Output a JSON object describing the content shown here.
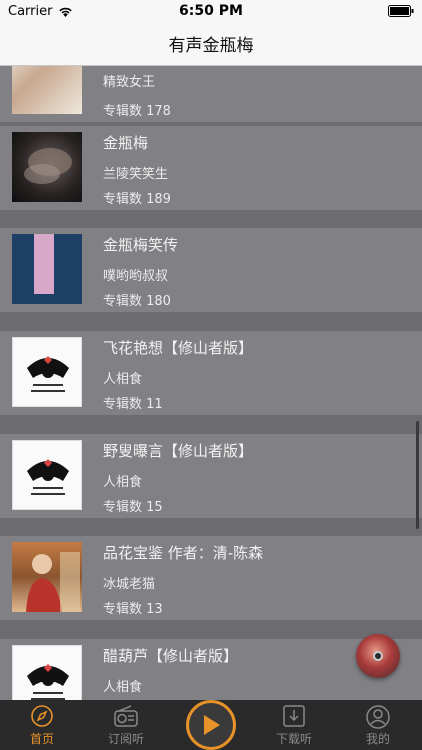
{
  "status_bar": {
    "carrier": "Carrier",
    "time": "6:50 PM"
  },
  "nav": {
    "title": "有声金瓶梅"
  },
  "albums": [
    {
      "title": "",
      "author": "精致女王",
      "count": "专辑数 178",
      "thumb": "t-photo1"
    },
    {
      "title": "金瓶梅",
      "author": "兰陵笑笑生",
      "count": "专辑数 189",
      "thumb": "t-dark"
    },
    {
      "title": "金瓶梅笑传",
      "author": "噗哟哟叔叔",
      "count": "专辑数 180",
      "thumb": "t-blue"
    },
    {
      "title": "飞花艳想【修山者版】",
      "author": "人相食",
      "count": "专辑数 11",
      "thumb": "t-logo"
    },
    {
      "title": "野叟曝言【修山者版】",
      "author": "人相食",
      "count": "专辑数 15",
      "thumb": "t-logo"
    },
    {
      "title": "品花宝鉴 作者：清-陈森",
      "author": "冰城老猫",
      "count": "专辑数 13",
      "thumb": "t-person"
    },
    {
      "title": "醋葫芦【修山者版】",
      "author": "人相食",
      "count": "",
      "thumb": "t-logo"
    }
  ],
  "tabs": [
    {
      "label": "首页",
      "icon": "compass-icon",
      "active": true
    },
    {
      "label": "订阅听",
      "icon": "radio-icon",
      "active": false
    },
    {
      "label": "",
      "icon": "play-icon",
      "active": false
    },
    {
      "label": "下载听",
      "icon": "download-icon",
      "active": false
    },
    {
      "label": "我的",
      "icon": "user-icon",
      "active": false
    }
  ],
  "colors": {
    "accent": "#e8922a",
    "tab_bar": "#2a2a2a"
  }
}
